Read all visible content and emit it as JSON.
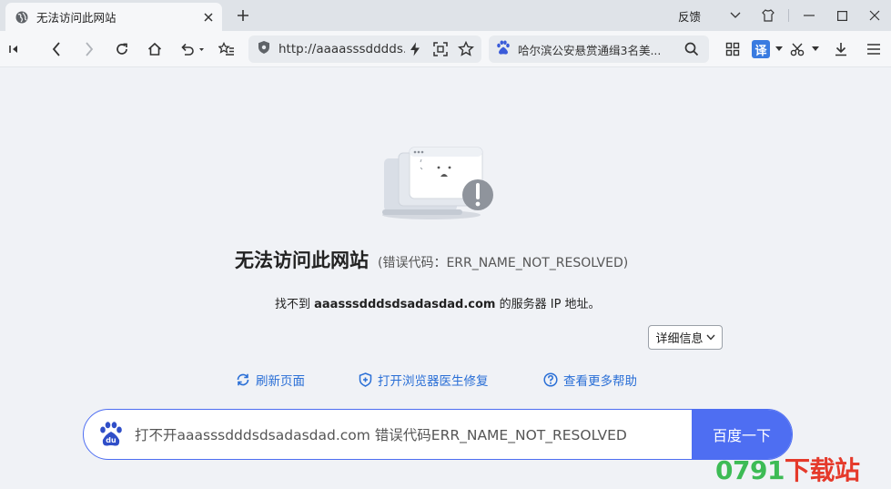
{
  "tab": {
    "title": "无法访问此网站"
  },
  "window": {
    "feedback_label": "反馈"
  },
  "address_bar": {
    "url": "http://aaaasssdddds..."
  },
  "search_bar": {
    "text": "哈尔滨公安悬赏通缉3名美..."
  },
  "translate_label": "译",
  "error": {
    "title": "无法访问此网站",
    "code_text": "(错误代码：ERR_NAME_NOT_RESOLVED)",
    "desc_prefix": "找不到 ",
    "desc_domain": "aaasssdddsdsadasdad.com",
    "desc_suffix": " 的服务器 IP 地址。",
    "details_button": "详细信息"
  },
  "actions": {
    "refresh": "刷新页面",
    "doctor": "打开浏览器医生修复",
    "help": "查看更多帮助"
  },
  "baidu_search": {
    "text": "打不开aaasssdddsdsadasdad.com 错误代码ERR_NAME_NOT_RESOLVED",
    "button": "百度一下",
    "logo_text": "du"
  },
  "watermark": {
    "digits": "0791",
    "cn": "下载站"
  },
  "colors": {
    "accent": "#2a6fd6",
    "baidu_blue": "#4e6ef2",
    "page_bg": "#f0f2f6"
  }
}
